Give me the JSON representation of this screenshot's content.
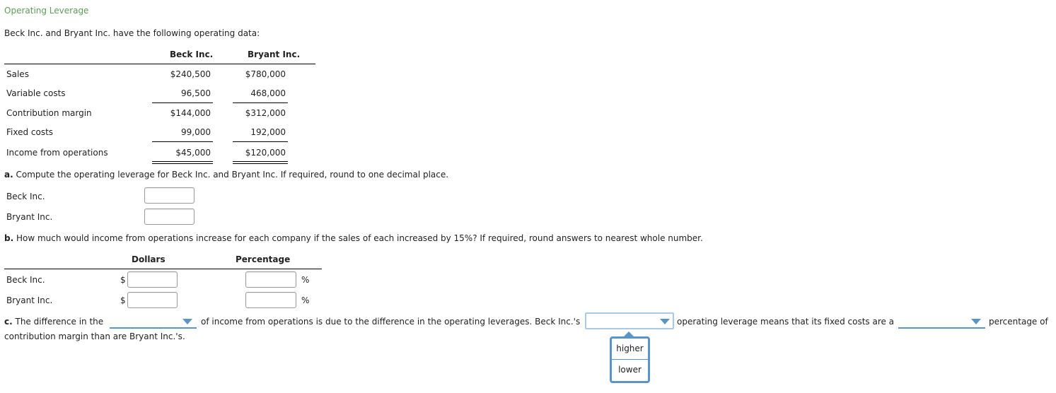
{
  "title": "Operating Leverage",
  "intro": "Beck Inc. and Bryant Inc. have the following operating data:",
  "table": {
    "headers": [
      "Beck Inc.",
      "Bryant Inc."
    ],
    "rows": [
      {
        "label": "Sales",
        "beck": "$240,500",
        "bryant": "$780,000"
      },
      {
        "label": "Variable costs",
        "beck": "96,500",
        "bryant": "468,000"
      },
      {
        "label": "Contribution margin",
        "beck": "$144,000",
        "bryant": "$312,000"
      },
      {
        "label": "Fixed costs",
        "beck": "99,000",
        "bryant": "192,000"
      },
      {
        "label": "Income from operations",
        "beck": "$45,000",
        "bryant": "$120,000"
      }
    ]
  },
  "part_a": {
    "letter": "a.",
    "question": "Compute the operating leverage for Beck Inc. and Bryant Inc. If required, round to one decimal place.",
    "rows": [
      {
        "label": "Beck Inc.",
        "value": ""
      },
      {
        "label": "Bryant Inc.",
        "value": ""
      }
    ]
  },
  "part_b": {
    "letter": "b.",
    "question": "How much would income from operations increase for each company if the sales of each increased by 15%? If required, round answers to nearest whole number.",
    "headers": [
      "Dollars",
      "Percentage"
    ],
    "currency_symbol": "$",
    "percent_symbol": "%",
    "rows": [
      {
        "label": "Beck Inc.",
        "dollars": "",
        "percentage": ""
      },
      {
        "label": "Bryant Inc.",
        "dollars": "",
        "percentage": ""
      }
    ]
  },
  "part_c": {
    "letter": "c.",
    "text1": "The difference in the",
    "text2": "of income from operations is due to the difference in the operating leverages. Beck Inc.'s",
    "text3": "operating leverage means that its fixed costs are a",
    "text4": "percentage of",
    "text5": "contribution margin than are Bryant Inc.'s.",
    "dropdown1_value": "",
    "dropdown2_value": "",
    "dropdown3_value": "",
    "open_dropdown_options": [
      "higher",
      "lower"
    ]
  }
}
